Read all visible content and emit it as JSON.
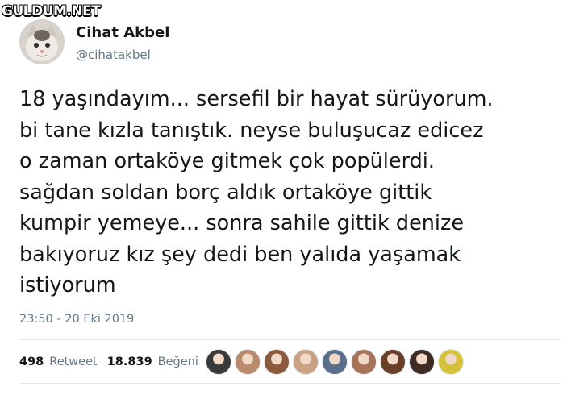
{
  "watermark": "GULDUM.NET",
  "user": {
    "display_name": "Cihat Akbel",
    "handle": "@cihatakbel",
    "avatar_icon": "cat-avatar-icon"
  },
  "tweet": {
    "text": "18 yaşındayım... sersefil bir hayat sürüyorum.\nbi tane kızla tanıştık. neyse buluşucaz edicez\no zaman ortaköye gitmek çok popülerdi.\nsağdan soldan borç aldık ortaköye gittik\nkumpir yemeye... sonra sahile gittik denize\nbakıyoruz kız şey dedi ben yalıda yaşamak\nistiyorum",
    "timestamp": "23:50 - 20 Eki 2019"
  },
  "stats": {
    "retweet_count": "498",
    "retweet_label": "Retweet",
    "like_count": "18.839",
    "like_label": "Beğeni"
  },
  "likers": [
    {
      "icon": "liker-avatar-icon",
      "color": "#3a3a3a"
    },
    {
      "icon": "liker-avatar-icon",
      "color": "#b98a6c"
    },
    {
      "icon": "liker-avatar-icon",
      "color": "#8a5a3c"
    },
    {
      "icon": "liker-avatar-icon",
      "color": "#c9a285"
    },
    {
      "icon": "liker-avatar-icon",
      "color": "#5b6f8a"
    },
    {
      "icon": "liker-avatar-icon",
      "color": "#a7745a"
    },
    {
      "icon": "liker-avatar-icon",
      "color": "#6a3f2a"
    },
    {
      "icon": "liker-avatar-icon",
      "color": "#3d2b24"
    },
    {
      "icon": "liker-avatar-icon",
      "color": "#d6c23a"
    }
  ],
  "colors": {
    "text": "#14171a",
    "secondary": "#657786",
    "divider": "#e1e8ed"
  }
}
